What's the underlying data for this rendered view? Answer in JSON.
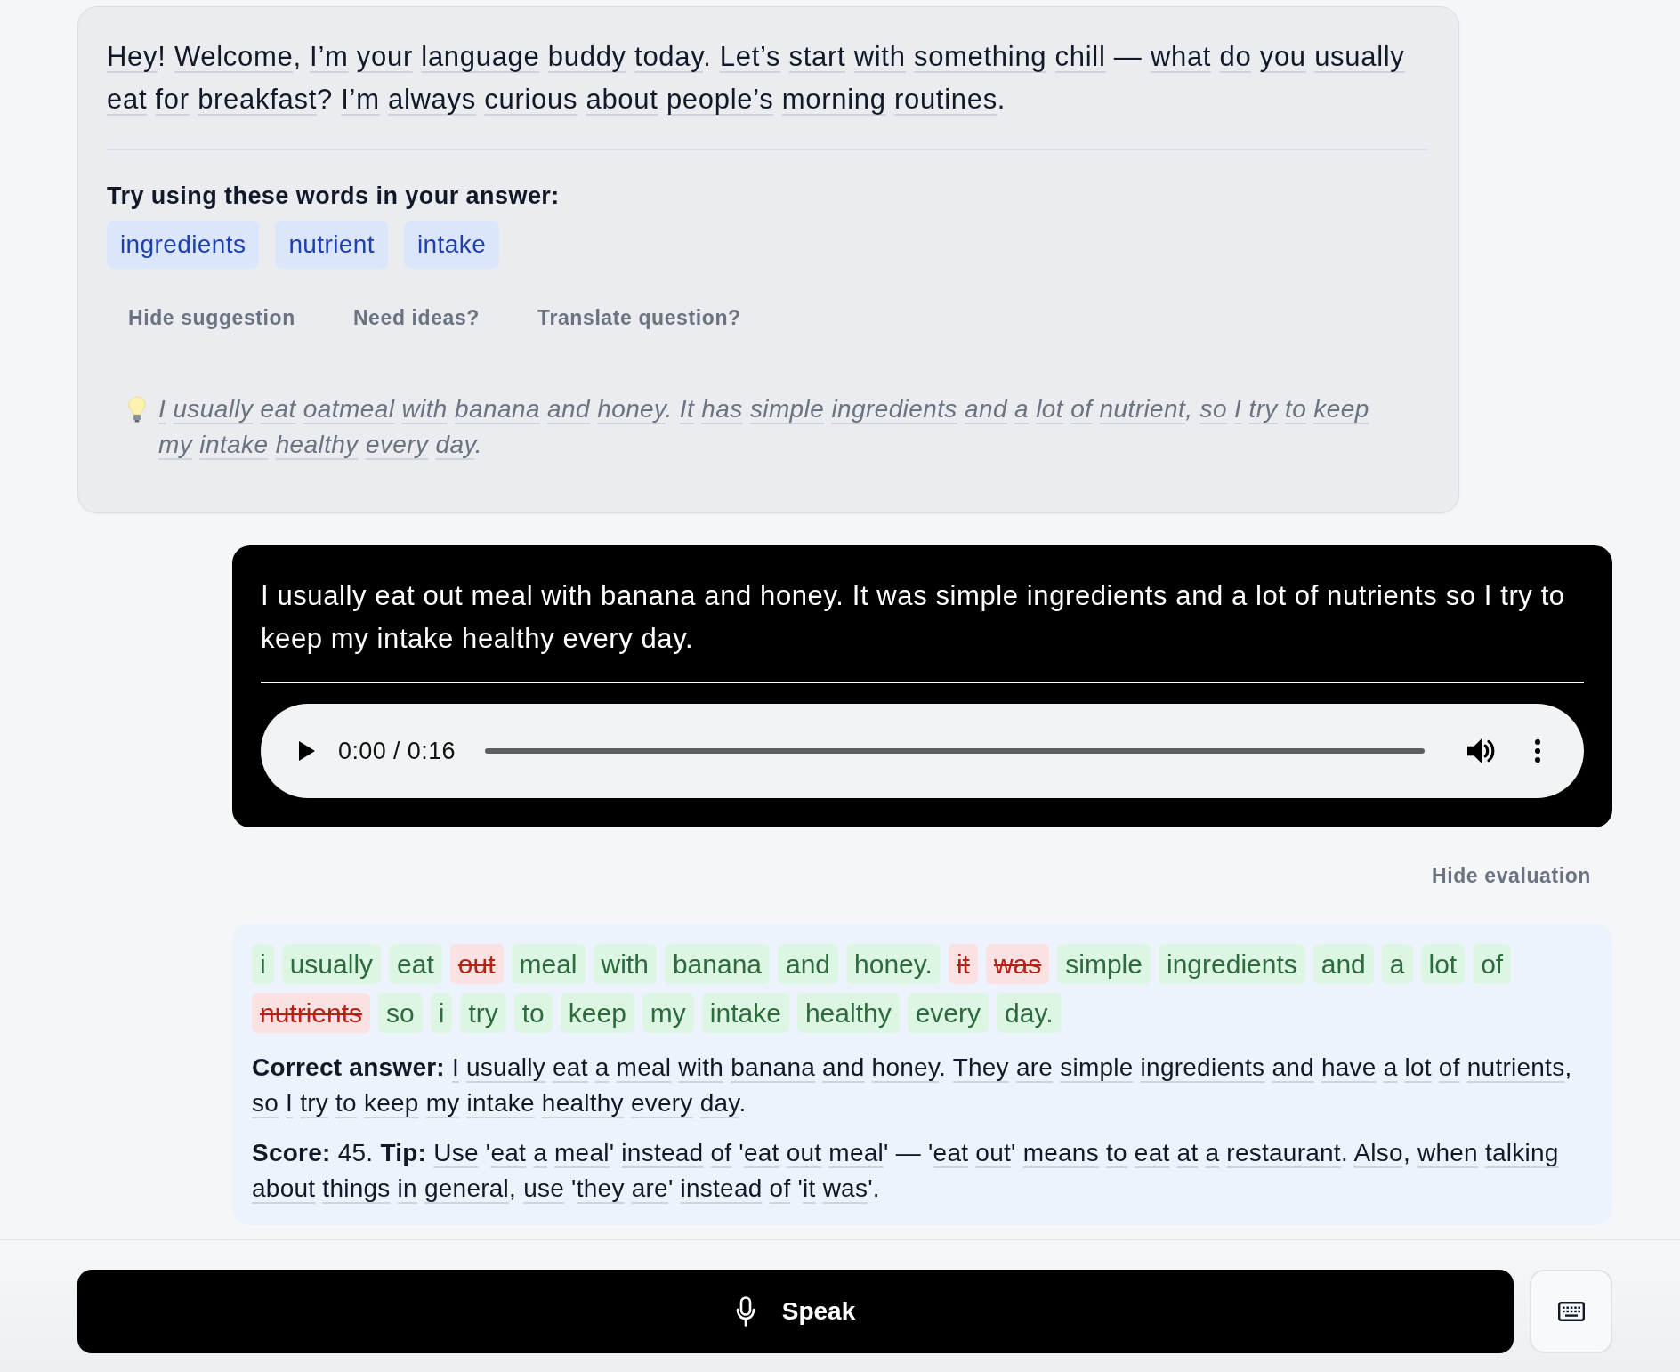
{
  "assistant_message": {
    "text": "Hey! Welcome, I’m your language buddy today. Let’s start with something chill — what do you usually eat for breakfast? I’m always curious about people’s morning routines.",
    "vocabulary_prompt": "Try using these words in your answer:",
    "vocabulary": [
      "ingredients",
      "nutrient",
      "intake"
    ],
    "actions": [
      "Hide suggestion",
      "Need ideas?",
      "Translate question?"
    ],
    "suggestion": "I usually eat oatmeal with banana and honey. It has simple ingredients and a lot of nutrient, so I try to keep my intake healthy every day."
  },
  "user_message": {
    "text": "I usually eat out meal with banana and honey. It was simple ingredients and a lot of nutrients so I try to keep my intake healthy every day.",
    "player": {
      "time": "0:00 / 0:16"
    }
  },
  "evaluation_toggle": "Hide evaluation",
  "evaluation": {
    "words": [
      {
        "text": "i",
        "kind": "correct"
      },
      {
        "text": "usually",
        "kind": "correct"
      },
      {
        "text": "eat",
        "kind": "correct"
      },
      {
        "text": "out",
        "kind": "wrong"
      },
      {
        "text": "meal",
        "kind": "correct"
      },
      {
        "text": "with",
        "kind": "correct"
      },
      {
        "text": "banana",
        "kind": "correct"
      },
      {
        "text": "and",
        "kind": "correct"
      },
      {
        "text": "honey.",
        "kind": "correct"
      },
      {
        "text": "it",
        "kind": "wrong"
      },
      {
        "text": "was",
        "kind": "wrong"
      },
      {
        "text": "simple",
        "kind": "correct"
      },
      {
        "text": "ingredients",
        "kind": "correct"
      },
      {
        "text": "and",
        "kind": "correct"
      },
      {
        "text": "a",
        "kind": "correct"
      },
      {
        "text": "lot",
        "kind": "correct"
      },
      {
        "text": "of",
        "kind": "correct"
      },
      {
        "text": "nutrients",
        "kind": "wrong"
      },
      {
        "text": "so",
        "kind": "correct"
      },
      {
        "text": "i",
        "kind": "correct"
      },
      {
        "text": "try",
        "kind": "correct"
      },
      {
        "text": "to",
        "kind": "correct"
      },
      {
        "text": "keep",
        "kind": "correct"
      },
      {
        "text": "my",
        "kind": "correct"
      },
      {
        "text": "intake",
        "kind": "correct"
      },
      {
        "text": "healthy",
        "kind": "correct"
      },
      {
        "text": "every",
        "kind": "correct"
      },
      {
        "text": "day.",
        "kind": "correct"
      }
    ],
    "correct_answer": {
      "label": "Correct answer:",
      "text": "I usually eat a meal with banana and honey. They are simple ingredients and have a lot of nutrients, so I try to keep my intake healthy every day."
    },
    "score": {
      "label": "Score:",
      "value": "45."
    },
    "tip": {
      "label": "Tip:",
      "text": "Use 'eat a meal' instead of 'eat out meal' — 'eat out' means to eat at a restaurant. Also, when talking about things in general, use 'they are' instead of 'it was'."
    }
  },
  "input_bar": {
    "speak_label": "Speak"
  }
}
